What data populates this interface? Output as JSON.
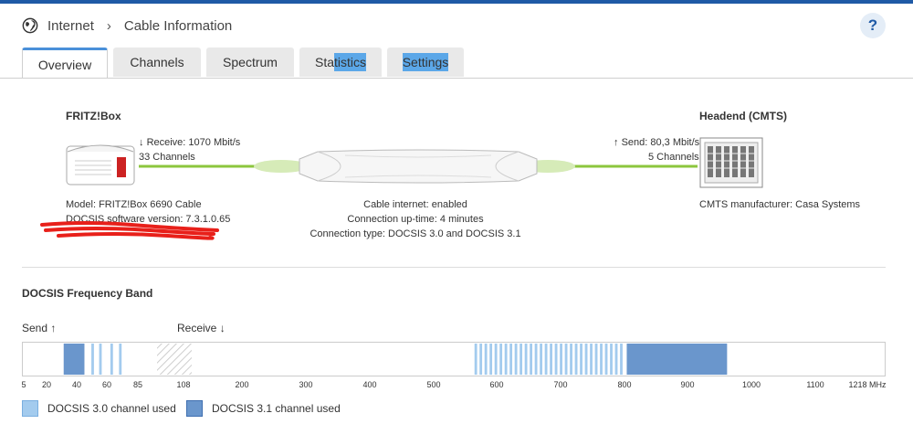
{
  "breadcrumb": {
    "root": "Internet",
    "page": "Cable Information"
  },
  "help_label": "?",
  "tabs": [
    {
      "label": "Overview",
      "active": true
    },
    {
      "label": "Channels"
    },
    {
      "label": "Spectrum"
    },
    {
      "label": "Statistics",
      "highlight_from": 3
    },
    {
      "label": "Settings"
    }
  ],
  "device": {
    "title": "FRITZ!Box",
    "receive": "Receive: 1070 Mbit/s",
    "receive_channels": "33 Channels",
    "model": "Model: FRITZ!Box 6690 Cable",
    "docsis_version": "DOCSIS software version: 7.3.1.0.65"
  },
  "headend": {
    "title": "Headend (CMTS)",
    "send": "Send: 80,3 Mbit/s",
    "send_channels": "5 Channels",
    "manufacturer": "CMTS manufacturer: Casa Systems"
  },
  "connection": {
    "cable_internet": "Cable internet: enabled",
    "uptime": "Connection up-time: 4 minutes",
    "type": "Connection type: DOCSIS 3.0 and DOCSIS 3.1"
  },
  "frequency_band": {
    "title": "DOCSIS Frequency Band",
    "send_label": "Send",
    "receive_label": "Receive",
    "ticks": [
      "5",
      "20",
      "40",
      "60",
      "85",
      "108",
      "200",
      "300",
      "400",
      "500",
      "600",
      "700",
      "800",
      "900",
      "1000",
      "1100",
      "1218 MHz"
    ],
    "docsis30_color": "#a3cbee",
    "docsis31_color": "#6a96cc"
  },
  "legend": {
    "docsis30": "DOCSIS 3.0 channel used",
    "docsis31": "DOCSIS 3.1 channel used"
  }
}
